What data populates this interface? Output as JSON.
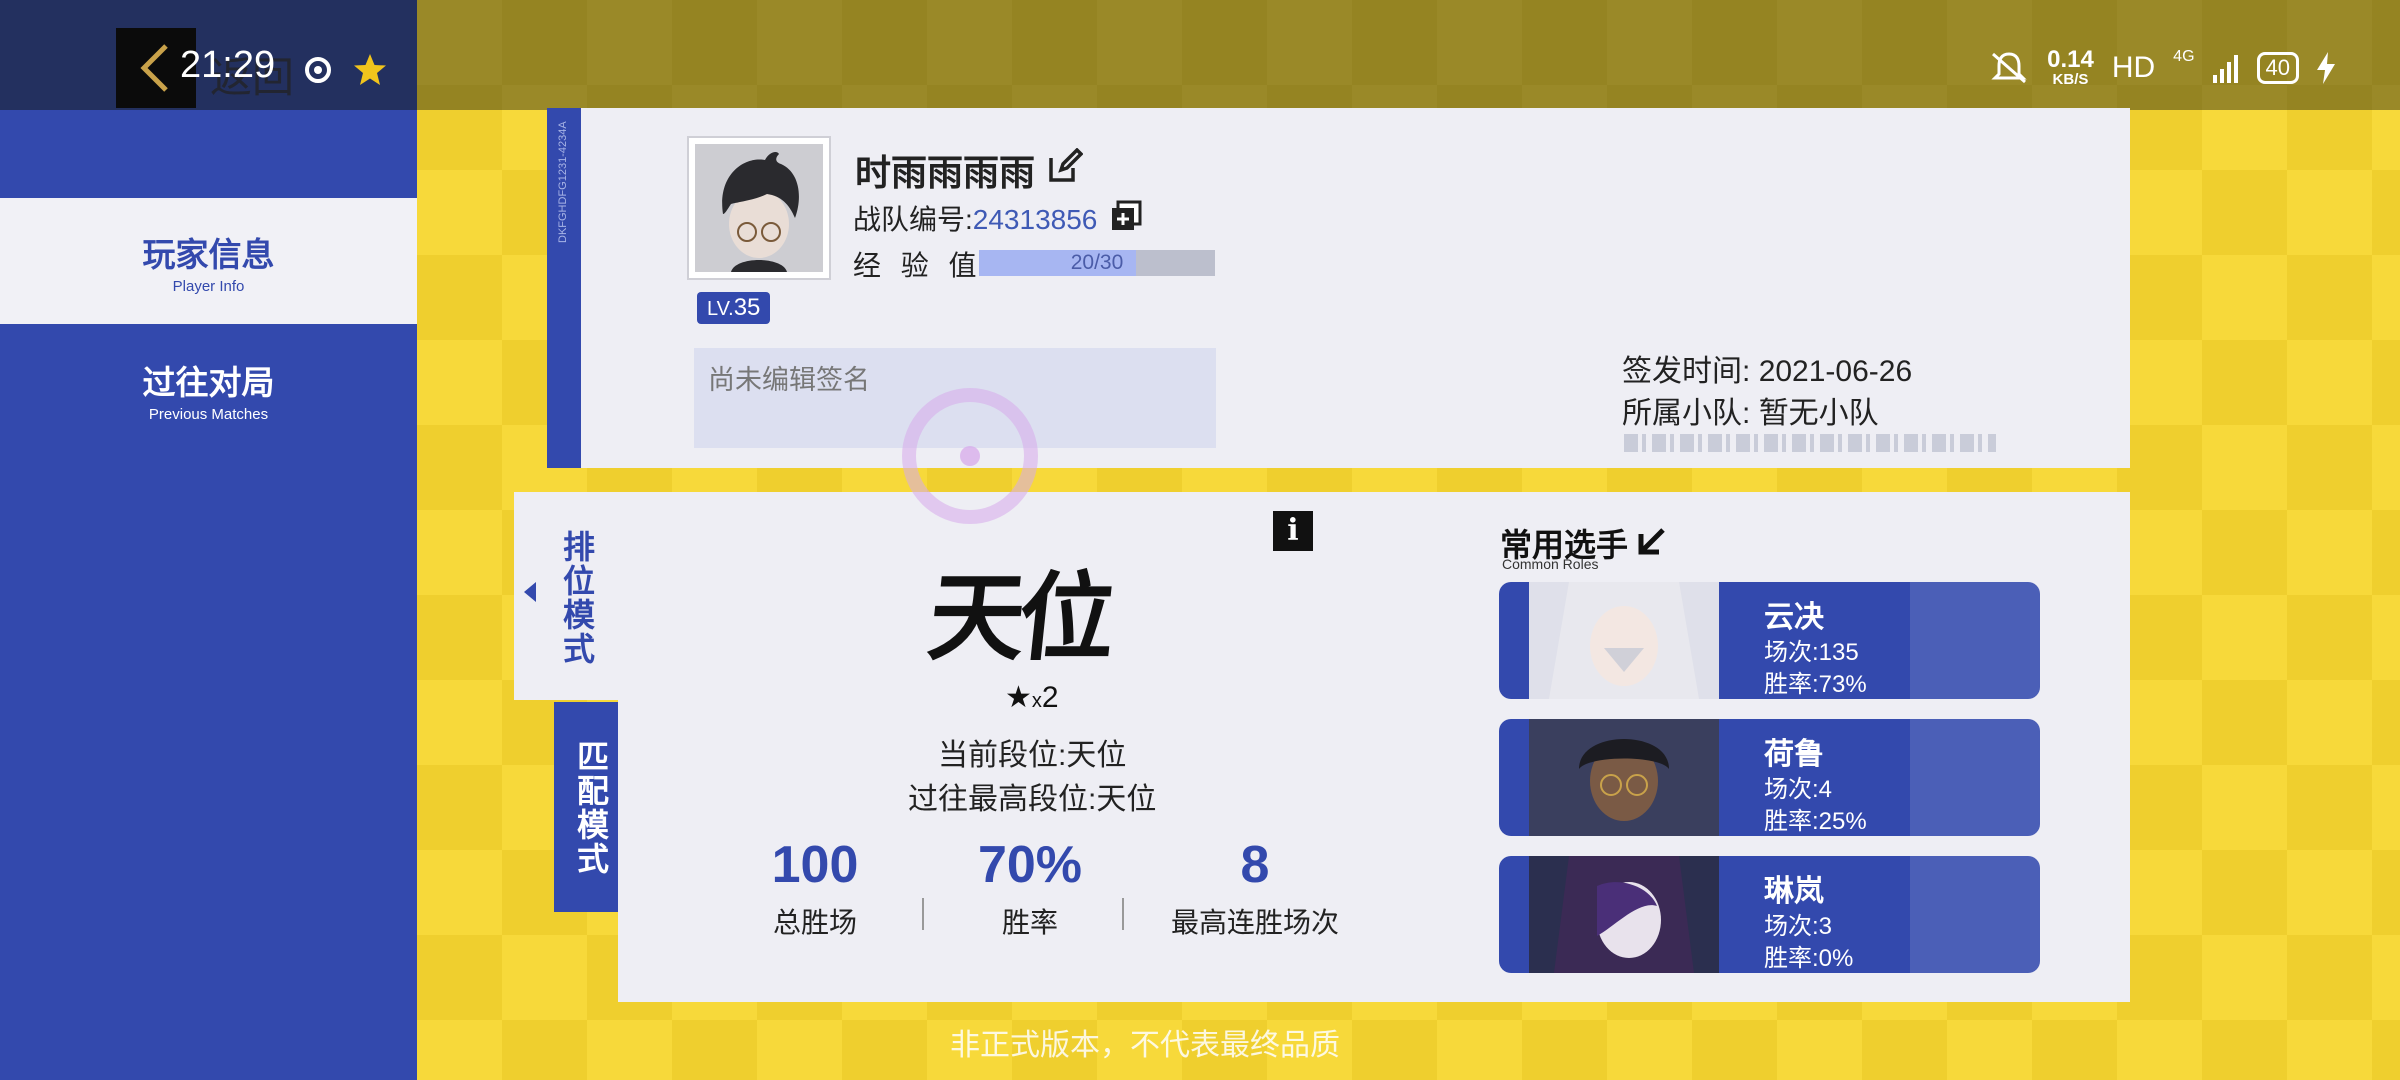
{
  "status_bar": {
    "time": "21:29",
    "net_speed": "0.14",
    "net_unit": "KB/S",
    "hd": "HD",
    "signal": "4G",
    "battery": "40"
  },
  "nav": {
    "back_label": "返回"
  },
  "sidebar": {
    "items": [
      {
        "label": "玩家信息",
        "sub": "Player Info",
        "active": true
      },
      {
        "label": "过往对局",
        "sub": "Previous Matches",
        "active": false
      }
    ]
  },
  "profile": {
    "strip_code": "DKFGHDFG1231-4234A",
    "name": "时雨雨雨雨",
    "team_id_label": "战队编号:",
    "team_id": "24313856",
    "exp_label": "经 验 值 :",
    "exp_text": "20/30",
    "exp_fraction": 0.667,
    "level_prefix": "LV.",
    "level": "35",
    "signature_placeholder": "尚未编辑签名",
    "issued_label": "签发时间:",
    "issued_date": "2021-06-26",
    "squad_label": "所属小队:",
    "squad_value": "暂无小队"
  },
  "modes": {
    "ranked": "排位模式",
    "match": "匹配模式"
  },
  "rank": {
    "logo_text": "天位",
    "stars_multiplier": "x",
    "stars_count": "2",
    "current_label": "当前段位:",
    "current_value": "天位",
    "highest_label": "过往最高段位:",
    "highest_value": "天位",
    "stats": [
      {
        "value": "100",
        "label": "总胜场"
      },
      {
        "value": "70%",
        "label": "胜率"
      },
      {
        "value": "8",
        "label": "最高连胜场次"
      }
    ]
  },
  "common_roles": {
    "title": "常用选手",
    "subtitle": "Common Roles",
    "matches_label": "场次:",
    "winrate_label": "胜率:",
    "roles": [
      {
        "name": "云决",
        "matches": "135",
        "winrate": "73%",
        "hair": "#e8e8ee",
        "face": "#f3e7e2"
      },
      {
        "name": "荷鲁",
        "matches": "4",
        "winrate": "25%",
        "hair": "#1c1c22",
        "face": "#7a5a45"
      },
      {
        "name": "琳岚",
        "matches": "3",
        "winrate": "0%",
        "hair": "#3b2a55",
        "face": "#e8e2ec"
      }
    ]
  },
  "footer": {
    "disclaimer": "非正式版本，不代表最终品质"
  },
  "colors": {
    "primary": "#3349ad",
    "background_yellow": "#f7d93a",
    "card": "#eeeef4"
  }
}
